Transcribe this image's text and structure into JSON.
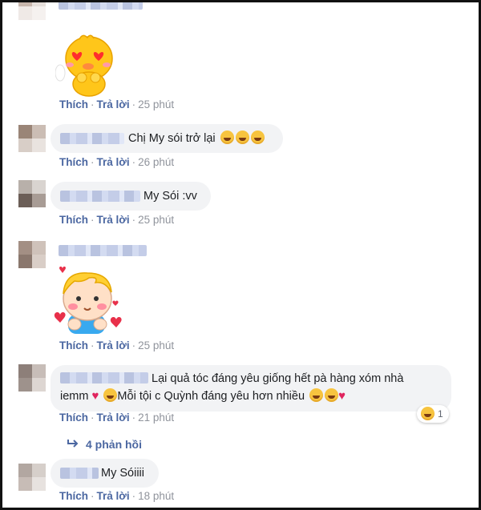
{
  "actions": {
    "like": "Thích",
    "reply": "Trả lời",
    "sep": "·"
  },
  "comments": [
    {
      "kind": "sticker",
      "time": "25 phút",
      "sticker": "heart-eyes-chick-sticker"
    },
    {
      "kind": "text",
      "text": "Chị My sói trở lại",
      "emojis": [
        "grinning-face",
        "grinning-face",
        "grinning-face"
      ],
      "time": "26 phút"
    },
    {
      "kind": "text",
      "text": "My Sói :vv",
      "time": "25 phút"
    },
    {
      "kind": "sticker",
      "time": "25 phút",
      "sticker": "blushing-boy-sticker"
    },
    {
      "kind": "text",
      "line1": "Lại quả tóc đáng yêu giống hết pà hàng xóm nhà",
      "line2a": "iemm",
      "line2b": "Mỗi tội c Quỳnh đáng yêu hơn nhiều",
      "time": "21 phút",
      "reaction_count": "1",
      "reaction": "laughing-face"
    },
    {
      "kind": "text",
      "text": "My Sóiiii",
      "time": "18 phút"
    }
  ],
  "replies_label": "4 phản hồi",
  "colors": {
    "link": "#4b67a1",
    "meta": "#90949c",
    "bubble": "#f2f3f5",
    "heart": "#e0245e"
  }
}
